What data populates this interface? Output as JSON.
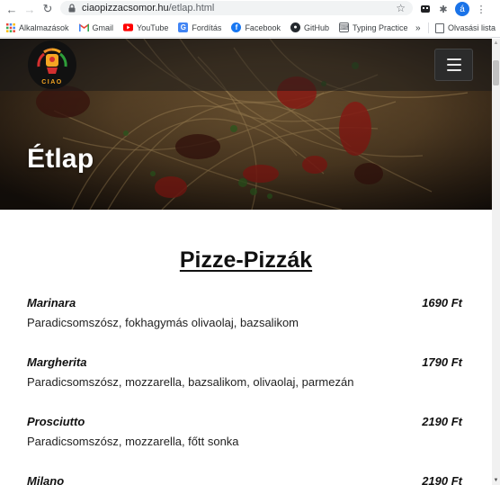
{
  "browser": {
    "url_host": "ciaopizzacsomor.hu",
    "url_path": "/etlap.html",
    "profile_initial": "á",
    "icons": [
      "back-arrow-icon",
      "forward-arrow-icon",
      "reload-icon",
      "lock-icon",
      "star-icon",
      "extension-icon",
      "puzzle-icon",
      "kebab-menu-icon"
    ]
  },
  "bookmarks": {
    "items": [
      {
        "label": "Alkalmazások",
        "icon": "apps-grid-icon"
      },
      {
        "label": "Gmail",
        "icon": "gmail-icon"
      },
      {
        "label": "YouTube",
        "icon": "youtube-icon"
      },
      {
        "label": "Fordítás",
        "icon": "translate-icon"
      },
      {
        "label": "Facebook",
        "icon": "facebook-icon"
      },
      {
        "label": "GitHub",
        "icon": "github-icon"
      },
      {
        "label": "Typing Practice",
        "icon": "typing-icon"
      }
    ],
    "more": "»",
    "reading_list": "Olvasási lista"
  },
  "site": {
    "logo_text": "CIAO",
    "hero_title": "Étlap"
  },
  "menu": {
    "section_title": "Pizze-Pizzák",
    "items": [
      {
        "name": "Marinara",
        "price": "1690 Ft",
        "desc": "Paradicsomszósz, fokhagymás olivaolaj, bazsalikom"
      },
      {
        "name": "Margherita",
        "price": "1790 Ft",
        "desc": "Paradicsomszósz, mozzarella, bazsalikom, olivaolaj, parmezán"
      },
      {
        "name": "Prosciutto",
        "price": "2190 Ft",
        "desc": "Paradicsomszósz, mozzarella, főtt sonka"
      },
      {
        "name": "Milano",
        "price": "2190 Ft",
        "desc": ""
      }
    ]
  },
  "colors": {
    "accent_blue": "#1a73e8",
    "logo_red": "#d32f2f",
    "logo_green": "#2e9e3a",
    "logo_orange": "#f5a623"
  }
}
